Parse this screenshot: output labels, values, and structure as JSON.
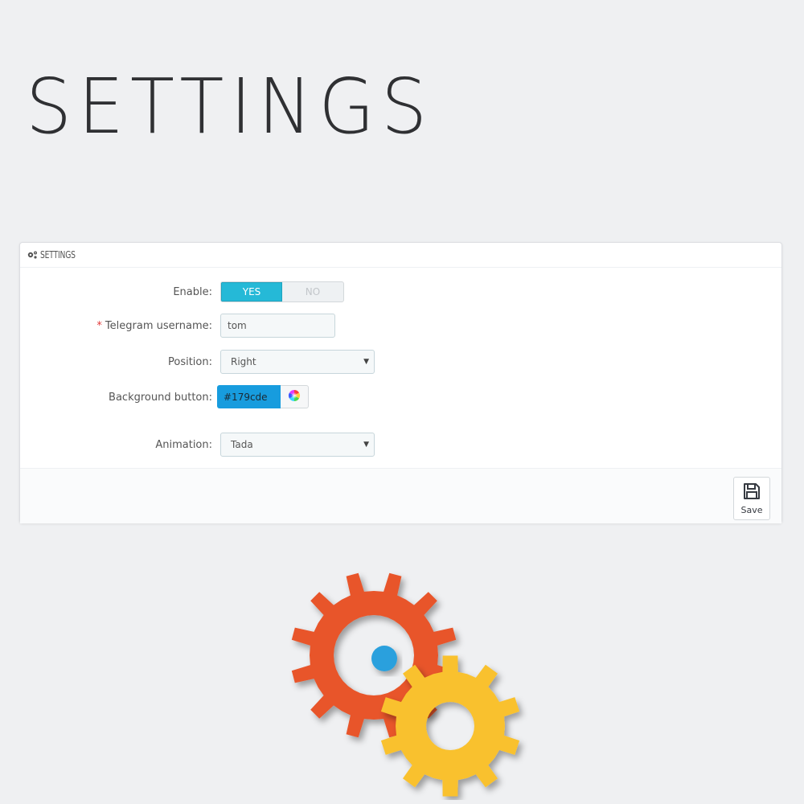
{
  "hero": {
    "title": "SETTINGS"
  },
  "panel": {
    "header_title": "SETTINGS",
    "enable": {
      "label": "Enable:",
      "yes": "YES",
      "no": "NO",
      "value": "YES"
    },
    "telegram": {
      "required_mark": "*",
      "label": "Telegram username:",
      "value": "tom"
    },
    "position": {
      "label": "Position:",
      "value": "Right"
    },
    "background": {
      "label": "Background button:",
      "value": "#179cde"
    },
    "animation": {
      "label": "Animation:",
      "value": "Tada"
    },
    "save_label": "Save"
  },
  "icons": {
    "header": "gears-icon",
    "color_picker": "color-wheel-icon",
    "save": "floppy-disk-icon",
    "dropdown": "caret-down-icon"
  },
  "colors": {
    "accent": "#25b9d7",
    "swatch": "#179cde",
    "gear_orange": "#e8542a",
    "gear_yellow": "#f9c12e",
    "dot_blue": "#2aa0dd"
  }
}
